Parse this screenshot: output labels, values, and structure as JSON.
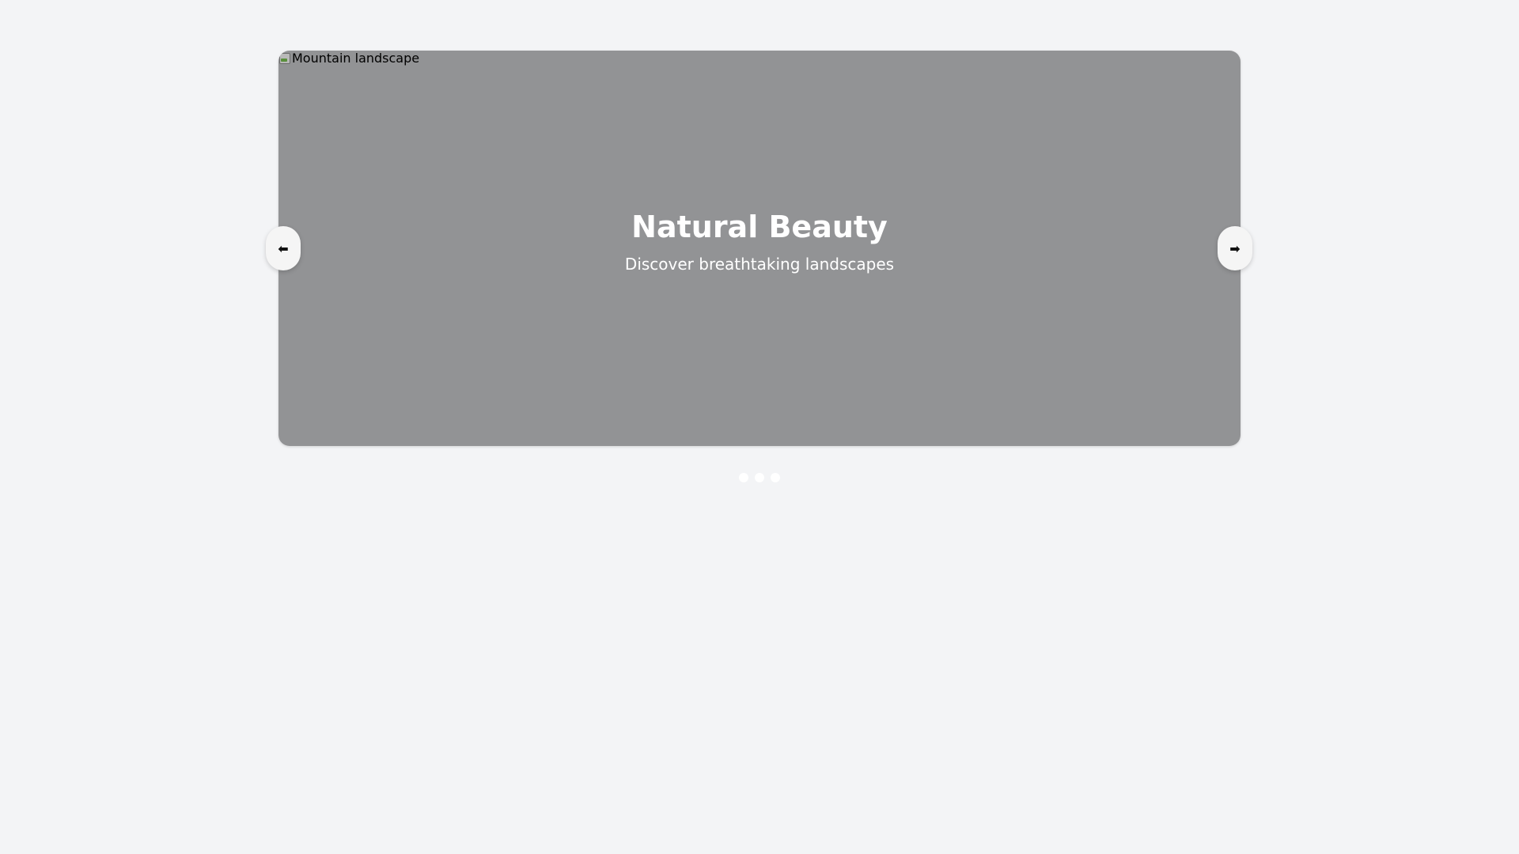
{
  "carousel": {
    "slide": {
      "image_alt": "Mountain landscape",
      "title": "Natural Beauty",
      "subtitle": "Discover breathtaking landscapes",
      "overlay_color": "#929395"
    },
    "prev_button": {
      "label": "⬅",
      "icon": "arrow-left-icon"
    },
    "next_button": {
      "label": "➡",
      "icon": "arrow-right-icon"
    },
    "indicators": {
      "count": 3,
      "active_index": 0
    }
  },
  "colors": {
    "page_background": "#f3f4f6",
    "text_on_slide": "#ffffff",
    "button_background": "#f5f5f5"
  }
}
